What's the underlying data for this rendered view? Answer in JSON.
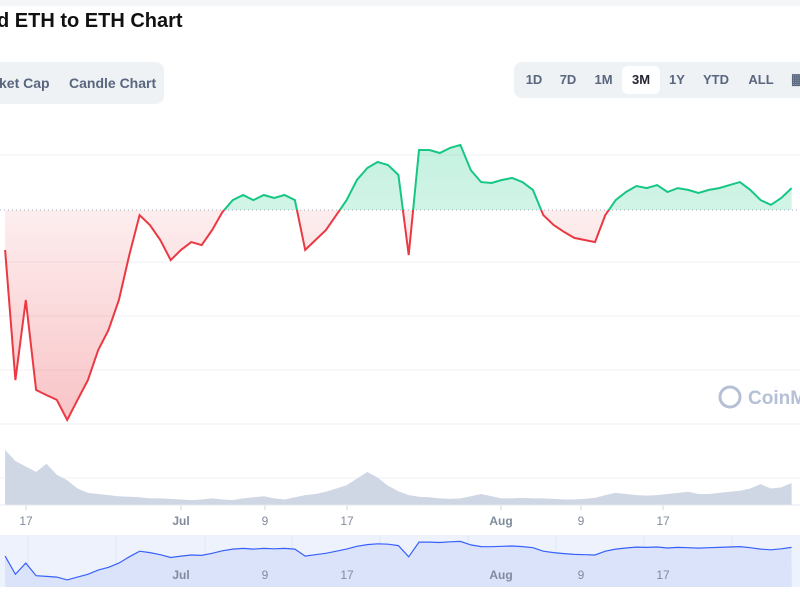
{
  "title": "d ETH to ETH Chart",
  "chart_type_tabs": [
    {
      "label": "ket Cap"
    },
    {
      "label": "Candle Chart"
    }
  ],
  "range_tabs": [
    {
      "label": "1D"
    },
    {
      "label": "7D"
    },
    {
      "label": "1M"
    },
    {
      "label": "3M",
      "active": true
    },
    {
      "label": "1Y"
    },
    {
      "label": "YTD"
    },
    {
      "label": "ALL"
    }
  ],
  "calendar_icon": "calendar-icon",
  "watermark": "CoinM",
  "colors": {
    "up": "#16c784",
    "down": "#ea3943",
    "volume": "#cfd6e4",
    "navigator_line": "#3861fb",
    "navigator_bg": "#eef2fd"
  },
  "chart_data": {
    "type": "line",
    "baseline": 100,
    "grid": true,
    "x": [
      "Jun 14",
      "Jun 15",
      "Jun 16",
      "Jun 17",
      "Jun 18",
      "Jun 19",
      "Jun 20",
      "Jun 21",
      "Jun 22",
      "Jun 23",
      "Jun 24",
      "Jun 25",
      "Jun 26",
      "Jun 27",
      "Jun 28",
      "Jun 29",
      "Jun 30",
      "Jul 1",
      "Jul 2",
      "Jul 3",
      "Jul 4",
      "Jul 5",
      "Jul 6",
      "Jul 7",
      "Jul 8",
      "Jul 9",
      "Jul 10",
      "Jul 11",
      "Jul 12",
      "Jul 13",
      "Jul 14",
      "Jul 15",
      "Jul 16",
      "Jul 17",
      "Jul 18",
      "Jul 19",
      "Jul 20",
      "Jul 21",
      "Jul 22",
      "Jul 23",
      "Jul 24",
      "Jul 25",
      "Jul 26",
      "Jul 27",
      "Jul 28",
      "Jul 29",
      "Jul 30",
      "Jul 31",
      "Aug 1",
      "Aug 2",
      "Aug 3",
      "Aug 4",
      "Aug 5",
      "Aug 6",
      "Aug 7",
      "Aug 8",
      "Aug 9",
      "Aug 10",
      "Aug 11",
      "Aug 12",
      "Aug 13",
      "Aug 14",
      "Aug 15",
      "Aug 16",
      "Aug 17",
      "Aug 18",
      "Aug 19",
      "Aug 20",
      "Aug 21",
      "Aug 22",
      "Aug 23",
      "Aug 24",
      "Aug 25",
      "Aug 26",
      "Aug 27",
      "Aug 28",
      "Aug 29"
    ],
    "price": [
      86.7,
      43.3,
      70,
      40,
      38.3,
      36.7,
      30,
      36.7,
      43.3,
      53.3,
      60,
      70,
      85,
      98.3,
      95,
      90,
      83.3,
      86.7,
      89.3,
      88.3,
      93.3,
      99.3,
      103.3,
      105,
      103.3,
      105,
      104,
      105,
      103.3,
      86.7,
      90,
      93.3,
      98.3,
      103.3,
      110,
      114,
      116,
      115,
      111.7,
      85,
      120,
      120,
      119,
      120.7,
      121.7,
      113.3,
      109.3,
      109,
      110,
      110.7,
      109.3,
      106.7,
      98.3,
      95,
      92.7,
      90.7,
      90,
      89.3,
      98.3,
      103.3,
      106,
      108,
      107.3,
      108.3,
      106,
      107.3,
      106.7,
      105.7,
      106.7,
      107.3,
      108.3,
      109.3,
      106.7,
      103.3,
      101.7,
      104,
      107.3
    ],
    "volume": [
      100,
      80,
      70,
      60,
      75,
      55,
      45,
      30,
      22,
      20,
      18,
      16,
      15,
      14,
      12,
      12,
      11,
      10,
      9,
      10,
      12,
      10,
      9,
      12,
      14,
      16,
      12,
      10,
      14,
      18,
      20,
      24,
      30,
      36,
      48,
      60,
      50,
      35,
      25,
      18,
      15,
      14,
      12,
      11,
      12,
      16,
      20,
      16,
      12,
      12,
      13,
      12,
      12,
      11,
      10,
      10,
      11,
      13,
      18,
      22,
      20,
      18,
      17,
      18,
      20,
      22,
      24,
      20,
      20,
      22,
      24,
      26,
      30,
      38,
      30,
      32,
      40
    ],
    "x_ticks": [
      {
        "label": "17",
        "bold": false
      },
      {
        "label": "Jul",
        "bold": true
      },
      {
        "label": "9",
        "bold": false
      },
      {
        "label": "17",
        "bold": false
      },
      {
        "label": "Aug",
        "bold": true
      },
      {
        "label": "9",
        "bold": false
      },
      {
        "label": "17",
        "bold": false
      }
    ],
    "navigator_ticks": [
      {
        "label": "Jul",
        "bold": true
      },
      {
        "label": "9",
        "bold": false
      },
      {
        "label": "17",
        "bold": false
      },
      {
        "label": "Aug",
        "bold": true
      },
      {
        "label": "9",
        "bold": false
      },
      {
        "label": "17",
        "bold": false
      }
    ]
  }
}
